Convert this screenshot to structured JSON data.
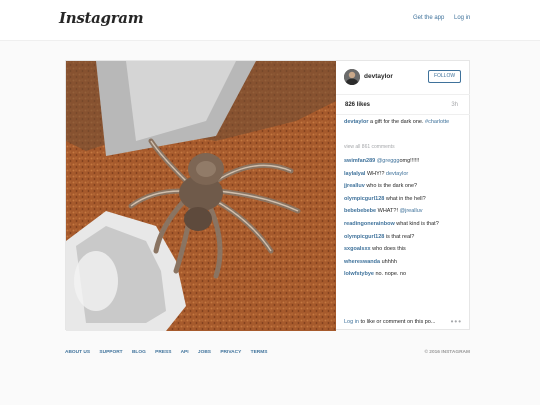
{
  "header": {
    "logo": "Instagram",
    "get_app": "Get the app",
    "login": "Log in"
  },
  "post": {
    "owner": "devtaylor",
    "follow": "FOLLOW",
    "likes": "826 likes",
    "age": "3h",
    "caption": {
      "user": "devtaylor",
      "text": "a gift for the dark one. ",
      "hashtag": "#charlotte"
    },
    "view_all": "view all 861 comments",
    "comments": [
      {
        "user": "swimfan289",
        "text": "omg!!!!!!",
        "mention": "@greggg"
      },
      {
        "user": "laylalyal",
        "text": "WHY!? ",
        "mention": "devtaylor"
      },
      {
        "user": "jjrealluv",
        "text": "who is the dark one?",
        "mention": ""
      },
      {
        "user": "olympicgurl128",
        "text": "what in the hell?",
        "mention": ""
      },
      {
        "user": "bebebebebe",
        "text": "WHAT?! ",
        "mention": "@jrealluv"
      },
      {
        "user": "readingonerainbow",
        "text": "what kind is that?",
        "mention": ""
      },
      {
        "user": "olympicgurl128",
        "text": "is that real?",
        "mention": ""
      },
      {
        "user": "sxgoalsxx",
        "text": "who does this",
        "mention": ""
      },
      {
        "user": "whereswanda",
        "text": "uhhhh",
        "mention": ""
      },
      {
        "user": "lolwfstybye",
        "text": "no. nope. no",
        "mention": ""
      }
    ],
    "login_prompt": {
      "link": "Log in",
      "text": " to like or comment on this po..."
    },
    "more": "•••"
  },
  "footer": {
    "links": [
      "ABOUT US",
      "SUPPORT",
      "BLOG",
      "PRESS",
      "API",
      "JOBS",
      "PRIVACY",
      "TERMS"
    ],
    "copyright": "© 2016 INSTAGRAM"
  },
  "colors": {
    "link": "#3f729b",
    "background": "#fafafa",
    "muted": "#a5a7aa"
  }
}
